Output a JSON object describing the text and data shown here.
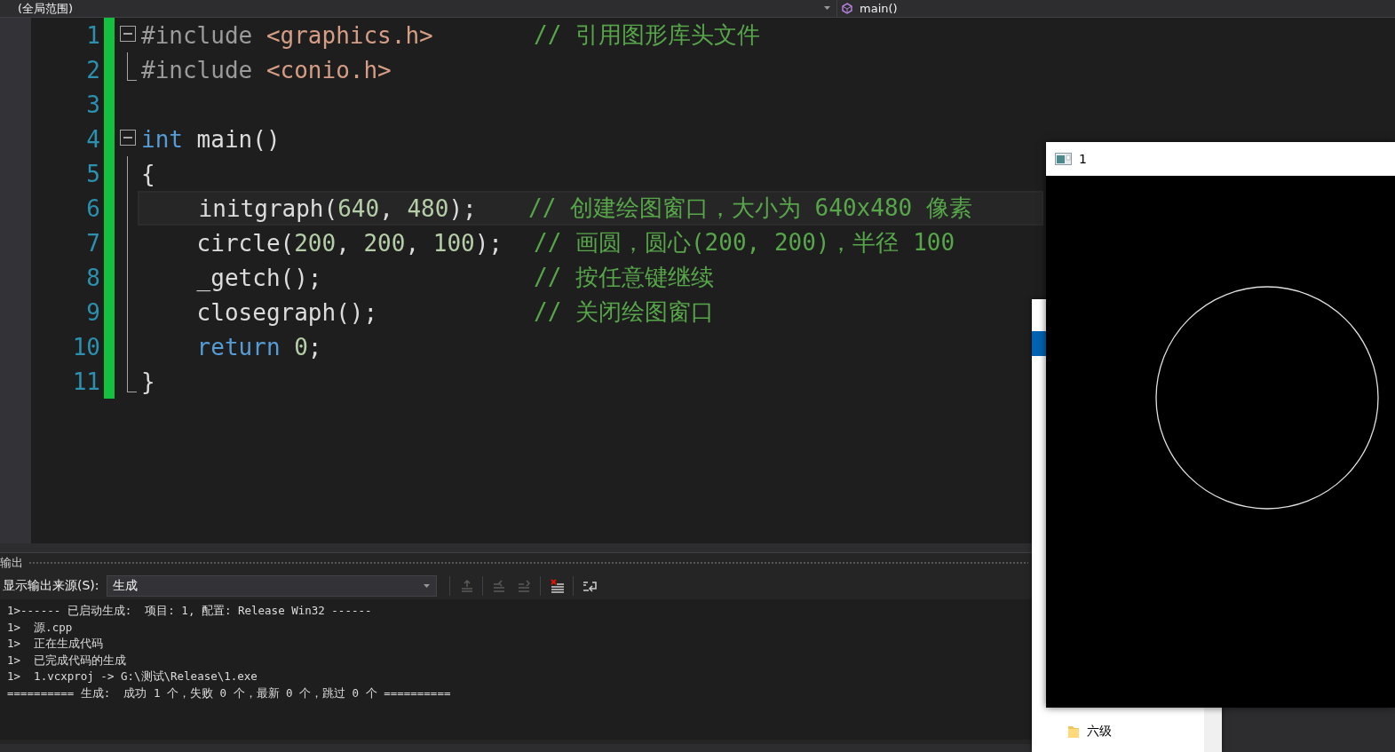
{
  "navigation_bar": {
    "scope": "(全局范围)",
    "member": "main()"
  },
  "editor": {
    "lines": [
      {
        "number": "1",
        "changed": true,
        "current": false,
        "fold": {
          "kind": "start",
          "expanded": true
        },
        "tokens": [
          {
            "kind": "preproc",
            "text": "#include "
          },
          {
            "kind": "path",
            "text": "<graphics.h>"
          }
        ],
        "comment": "// 引用图形库头文件"
      },
      {
        "number": "2",
        "changed": true,
        "current": false,
        "fold": {
          "kind": "end"
        },
        "tokens": [
          {
            "kind": "preproc",
            "text": "#include "
          },
          {
            "kind": "path",
            "text": "<conio.h>"
          }
        ]
      },
      {
        "number": "3",
        "changed": true,
        "current": false
      },
      {
        "number": "4",
        "changed": true,
        "current": false,
        "fold": {
          "kind": "start",
          "expanded": true
        },
        "tokens": [
          {
            "kind": "keyword",
            "text": "int"
          },
          {
            "kind": "plain",
            "text": " main()"
          }
        ]
      },
      {
        "number": "5",
        "changed": true,
        "current": false,
        "fold": {
          "kind": "line"
        },
        "tokens": [
          {
            "kind": "plain",
            "text": "{"
          }
        ]
      },
      {
        "number": "6",
        "changed": true,
        "current": true,
        "fold": {
          "kind": "line"
        },
        "tokens": [
          {
            "kind": "plain",
            "text": "    initgraph("
          },
          {
            "kind": "number",
            "text": "640"
          },
          {
            "kind": "plain",
            "text": ", "
          },
          {
            "kind": "number",
            "text": "480"
          },
          {
            "kind": "plain",
            "text": ");"
          }
        ],
        "comment": "// 创建绘图窗口，大小为 640x480 像素"
      },
      {
        "number": "7",
        "changed": true,
        "current": false,
        "fold": {
          "kind": "line"
        },
        "tokens": [
          {
            "kind": "plain",
            "text": "    circle("
          },
          {
            "kind": "number",
            "text": "200"
          },
          {
            "kind": "plain",
            "text": ", "
          },
          {
            "kind": "number",
            "text": "200"
          },
          {
            "kind": "plain",
            "text": ", "
          },
          {
            "kind": "number",
            "text": "100"
          },
          {
            "kind": "plain",
            "text": ");"
          }
        ],
        "comment": "// 画圆，圆心(200, 200)，半径 100"
      },
      {
        "number": "8",
        "changed": true,
        "current": false,
        "fold": {
          "kind": "line"
        },
        "tokens": [
          {
            "kind": "plain",
            "text": "    _getch();"
          }
        ],
        "comment": "// 按任意键继续"
      },
      {
        "number": "9",
        "changed": true,
        "current": false,
        "fold": {
          "kind": "line"
        },
        "tokens": [
          {
            "kind": "plain",
            "text": "    closegraph();"
          }
        ],
        "comment": "// 关闭绘图窗口"
      },
      {
        "number": "10",
        "changed": true,
        "current": false,
        "fold": {
          "kind": "line"
        },
        "tokens": [
          {
            "kind": "keyword",
            "text": "    return "
          },
          {
            "kind": "number",
            "text": "0"
          },
          {
            "kind": "plain",
            "text": ";"
          }
        ]
      },
      {
        "number": "11",
        "changed": true,
        "current": false,
        "fold": {
          "kind": "end"
        },
        "tokens": [
          {
            "kind": "plain",
            "text": "}"
          }
        ]
      }
    ]
  },
  "output": {
    "title": "输出",
    "source_label": "显示输出来源(S):",
    "source_value": "生成",
    "tools": [
      {
        "kind": "goto",
        "disabled": true
      },
      {
        "kind": "prev",
        "disabled": true
      },
      {
        "kind": "next",
        "disabled": true
      },
      {
        "kind": "clear",
        "disabled": false
      },
      {
        "kind": "wrap",
        "disabled": false
      }
    ],
    "lines": [
      "1>------ 已启动生成:  项目: 1, 配置: Release Win32 ------",
      "1>  源.cpp",
      "1>  正在生成代码",
      "1>  已完成代码的生成",
      "1>  1.vcxproj -> G:\\测试\\Release\\1.exe",
      "========== 生成:  成功 1 个，失败 0 个，最新 0 个，跳过 0 个 =========="
    ]
  },
  "explorer": {
    "items": [
      "六级"
    ]
  },
  "graphics_window": {
    "title": "1"
  }
}
